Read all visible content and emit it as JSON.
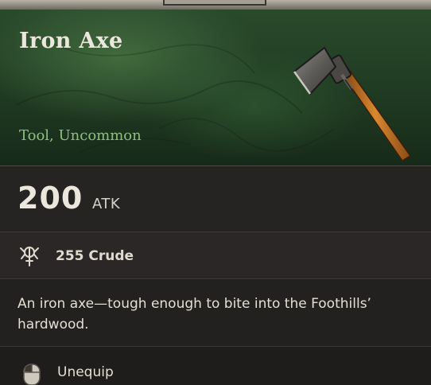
{
  "item": {
    "name": "Iron Axe",
    "type": "Tool, Uncommon",
    "icon": "iron-axe-icon"
  },
  "stats": {
    "atk_value": "200",
    "atk_label": "ATK"
  },
  "material": {
    "icon": "crude-material-icon",
    "text": "255 Crude"
  },
  "description": "An iron axe—tough enough to bite into the Foothills’ hardwood.",
  "action": {
    "icon": "mouse-click-icon",
    "label": "Unequip"
  },
  "colors": {
    "rarity": "#8fc07b",
    "header_bg": "#1f3a22",
    "panel_bg": "#1f1d1d"
  }
}
